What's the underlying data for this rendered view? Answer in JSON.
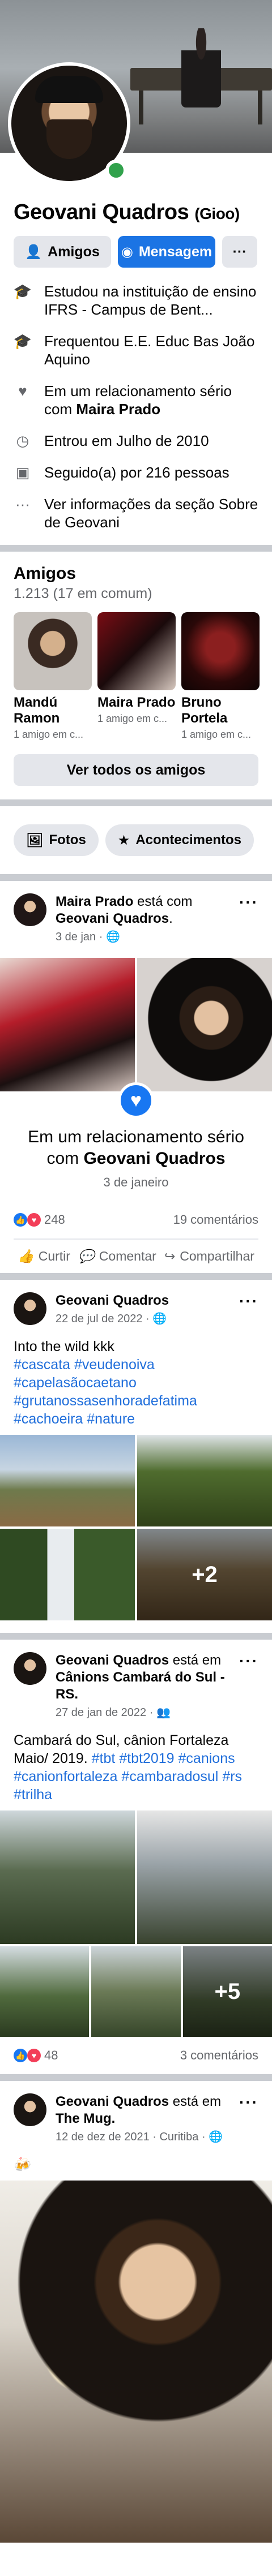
{
  "profile": {
    "name": "Geovani Quadros",
    "nickname": "(Gioo)"
  },
  "actions": {
    "friends": "Amigos",
    "message": "Mensagem",
    "more": "···"
  },
  "details": [
    {
      "icon": "graduation-icon",
      "text": "Estudou na instituição de ensino IFRS - Campus de Bent..."
    },
    {
      "icon": "graduation-icon",
      "text": "Frequentou E.E. Educ Bas João Aquino"
    },
    {
      "icon": "heart-icon",
      "prefix": "Em um relacionamento sério com ",
      "bold": "Maira Prado"
    },
    {
      "icon": "clock-icon",
      "text": "Entrou em Julho de 2010"
    },
    {
      "icon": "rss-icon",
      "text": "Seguido(a) por 216 pessoas"
    },
    {
      "icon": "ellipsis-icon",
      "text": "Ver informações da seção Sobre de Geovani"
    }
  ],
  "friends": {
    "title": "Amigos",
    "count": "1.213 (17 em comum)",
    "items": [
      {
        "name": "Mandú Ramon",
        "mutual": "1 amigo em c..."
      },
      {
        "name": "Maira Prado",
        "mutual": "1 amigo em c..."
      },
      {
        "name": "Bruno Portela",
        "mutual": "1 amigo em c..."
      }
    ],
    "see_all": "Ver todos os amigos"
  },
  "chips": {
    "photos": "Fotos",
    "events": "Acontecimentos"
  },
  "colors": {
    "brand": "#1b74e4",
    "online": "#31a24c",
    "like": "#1877f2",
    "love": "#f33e58"
  },
  "posts": [
    {
      "author": "Maira Prado",
      "with_text": " está com ",
      "with": "Geovani Quadros",
      "with_end": ".",
      "date": "3 de jan",
      "privacy": "globe-icon",
      "event_title_pre": "Em um relacionamento sério com ",
      "event_title_bold": "Geovani Quadros",
      "event_date": "3 de janeiro",
      "reactions": "248",
      "comments": "19 comentários",
      "like": "Curtir",
      "comment": "Comentar",
      "share": "Compartilhar"
    },
    {
      "author": "Geovani Quadros",
      "date": "22 de jul de 2022",
      "privacy": "globe-icon",
      "text": "Into the wild kkk",
      "tags": [
        "#cascata",
        "#veudenoiva",
        "#capelasãocaetano",
        "#grutanossasenhoradefatima",
        "#cachoeira",
        "#nature"
      ],
      "more_count": "+2"
    },
    {
      "author": "Geovani Quadros",
      "place_text": " está em ",
      "place": "Cânions Cambará do Sul - RS.",
      "date": "27 de jan de 2022",
      "privacy": "friends-icon",
      "text": "Cambará do Sul, cânion Fortaleza Maio/ 2019.",
      "tags": [
        "#tbt",
        "#tbt2019",
        "#canions",
        "#canionfortaleza",
        "#cambaradosul",
        "#rs",
        "#trilha"
      ],
      "more_count": "+5",
      "reactions": "48",
      "comments": "3 comentários"
    },
    {
      "author": "Geovani Quadros",
      "place_text": " está em ",
      "place": "The Mug.",
      "date": "12 de dez de 2021",
      "location": "Curitiba",
      "privacy": "globe-icon",
      "emoji": "🍻"
    }
  ]
}
